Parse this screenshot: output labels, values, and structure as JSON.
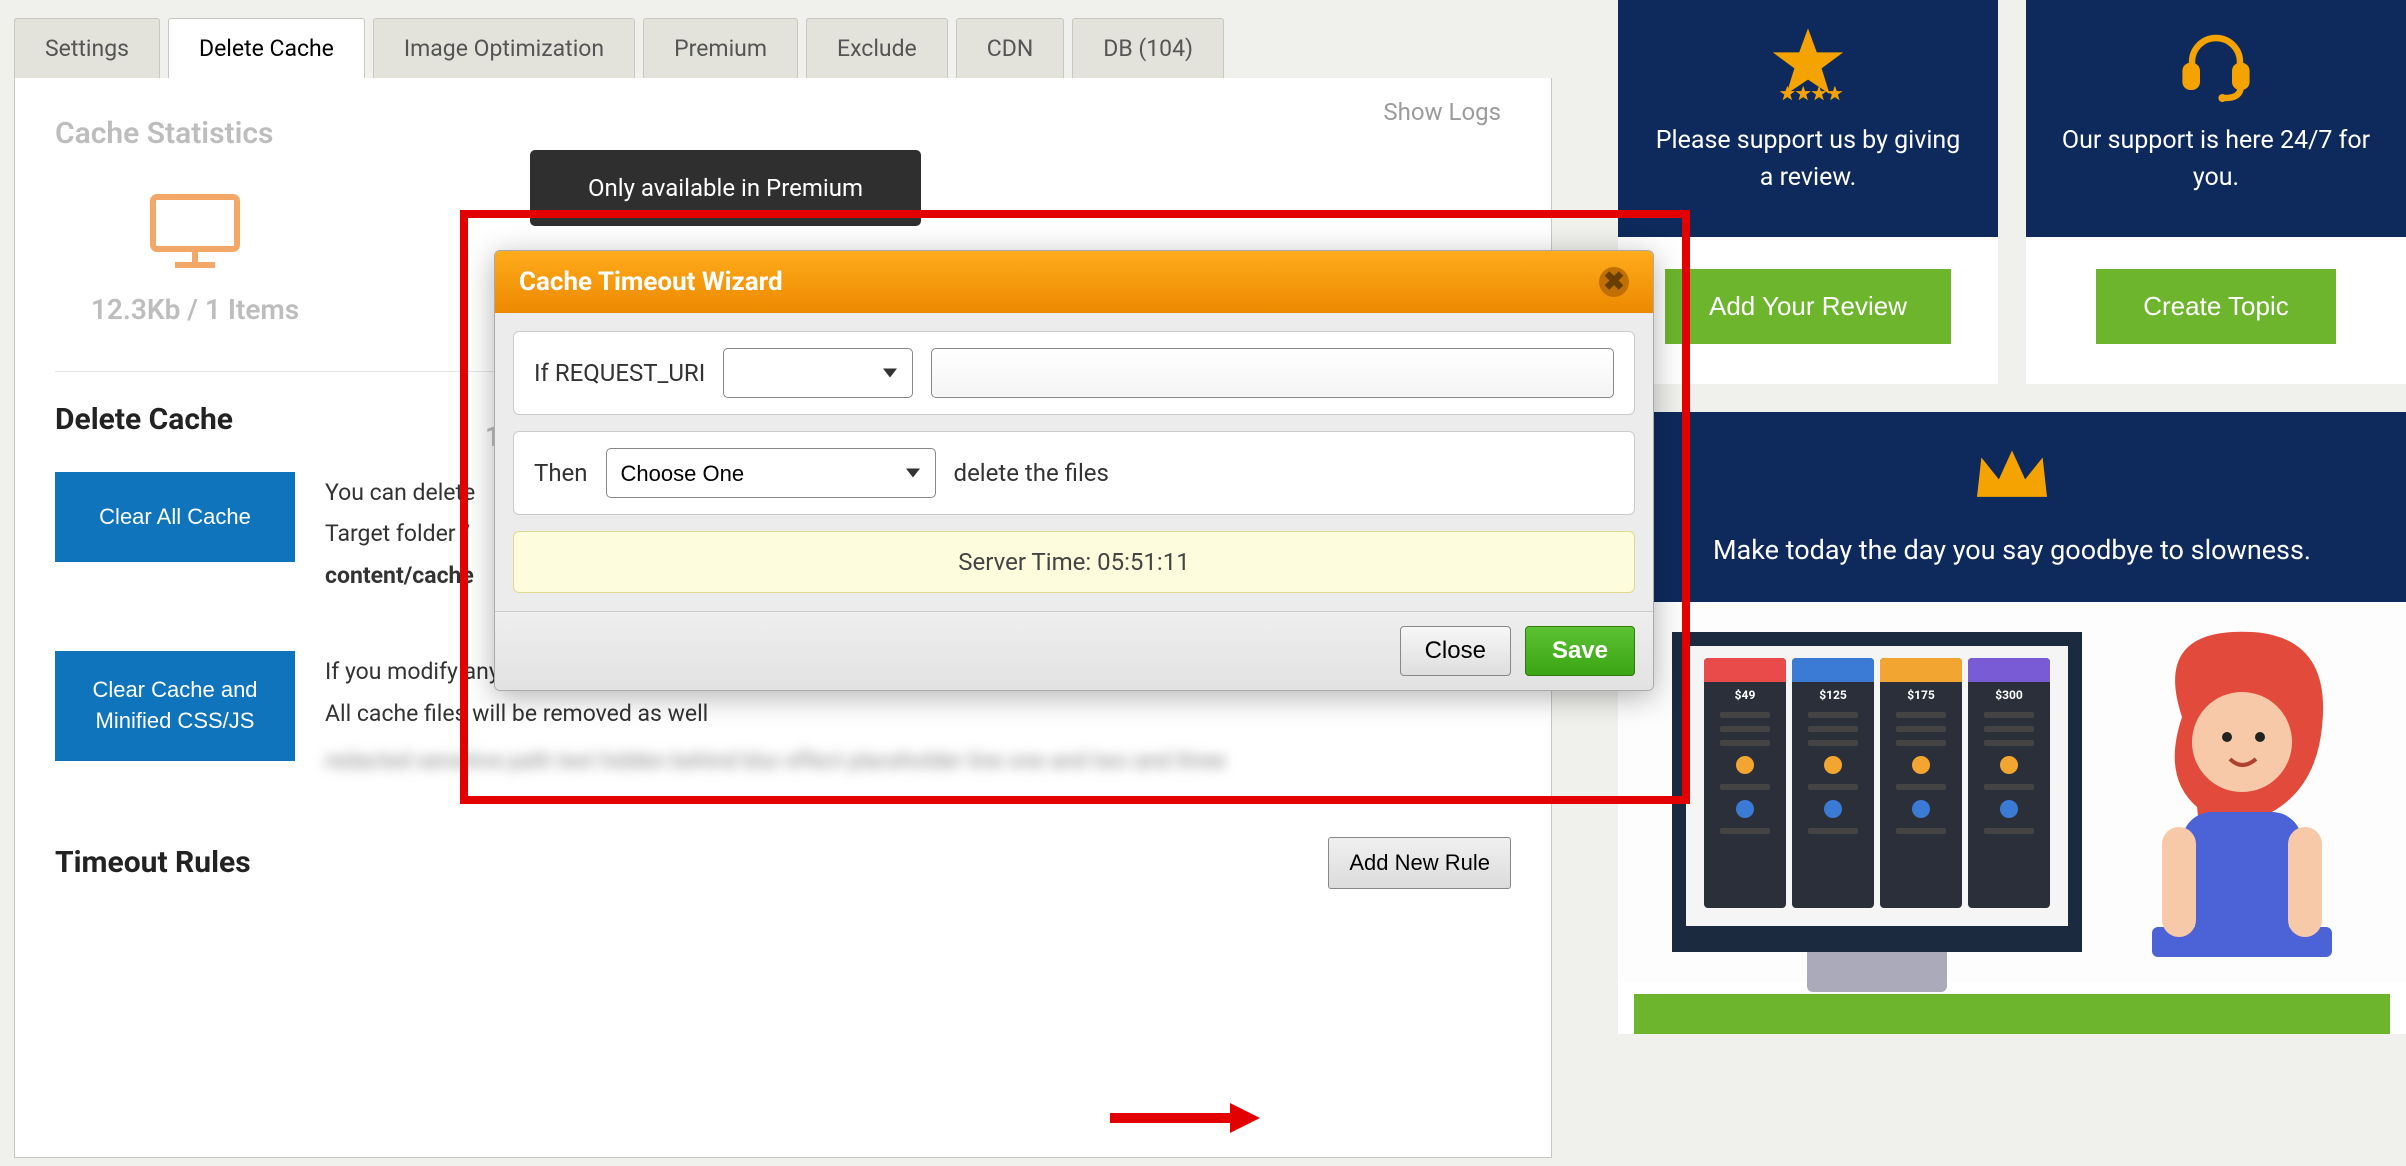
{
  "tabs": {
    "settings": "Settings",
    "delete_cache": "Delete Cache",
    "image_opt": "Image Optimization",
    "premium": "Premium",
    "exclude": "Exclude",
    "cdn": "CDN",
    "db": "DB (104)"
  },
  "show_logs": "Show Logs",
  "cache_stats": {
    "title": "Cache Statistics",
    "stat1": "12.3Kb / 1 Items",
    "stat2": "12"
  },
  "delete_cache": {
    "title": "Delete Cache",
    "clear_all_btn": "Clear All Cache",
    "clear_all_desc_line1": "You can delete",
    "clear_all_desc_line2_a": "Target folder ",
    "clear_all_desc_line2_b": "/",
    "clear_all_desc_line3": "content/cache",
    "clear_css_btn": "Clear Cache and Minified CSS/JS",
    "clear_css_desc_line1": "If you modify any css file, you have to delete minified css files",
    "clear_css_desc_line2": "All cache files will be removed as well",
    "blurred": "redacted sensitive path text hidden behind blur effect placeholder line one and two and three"
  },
  "timeout": {
    "title": "Timeout Rules",
    "add_btn": "Add New Rule"
  },
  "tooltip": "Only available in Premium",
  "modal": {
    "title": "Cache Timeout Wizard",
    "if_label": "If REQUEST_URI",
    "then_label": "Then",
    "choose_one": "Choose One",
    "delete_files": "delete the files",
    "server_time": "Server Time: 05:51:11",
    "close": "Close",
    "save": "Save"
  },
  "sidebar": {
    "review": {
      "msg": "Please support us by giving a review.",
      "btn": "Add Your Review"
    },
    "support": {
      "msg": "Our support is here 24/7 for you.",
      "btn": "Create Topic"
    },
    "premium": {
      "msg": "Make today the day you say goodbye to slowness.",
      "plans": [
        "$49",
        "$125",
        "$175",
        "$300"
      ]
    }
  }
}
